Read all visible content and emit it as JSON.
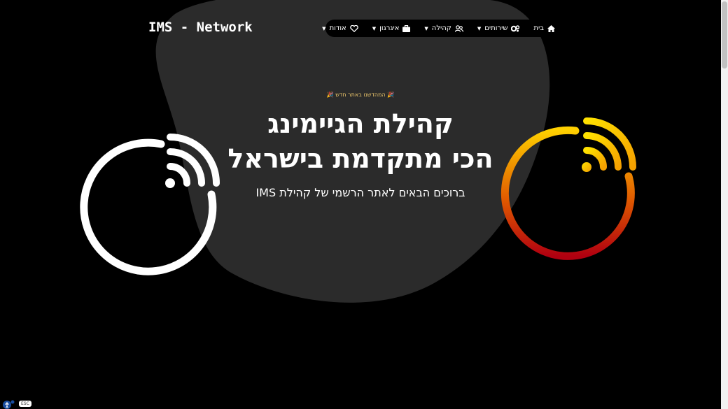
{
  "brand": {
    "logo_text": "IMS - Network"
  },
  "nav": {
    "items": [
      {
        "label": "בית",
        "icon": "home-icon",
        "has_dropdown": false
      },
      {
        "label": "שירותים",
        "icon": "gears-icon",
        "has_dropdown": true
      },
      {
        "label": "קהילה",
        "icon": "users-icon",
        "has_dropdown": true
      },
      {
        "label": "איגרגון",
        "icon": "briefcase-icon",
        "has_dropdown": true
      },
      {
        "label": "אודות",
        "icon": "heart-icon",
        "has_dropdown": true
      }
    ]
  },
  "hero": {
    "eyebrow": "🎉 המהדשנו באתר חדש 🎉",
    "title_line1": "קהילת הגיימינג",
    "title_line2": "הכי מתקדמת בישראל",
    "subtitle": "ברוכים הבאים לאתר הרשמי של קהילת IMS"
  },
  "accessibility": {
    "esc_label": "ESC",
    "icon": "accessibility-icon"
  },
  "colors": {
    "background": "#000000",
    "blob": "#2b2b2b",
    "accent_yellow": "#ffd700",
    "accent_red": "#c01010",
    "eyebrow_text": "#e9c46a"
  }
}
